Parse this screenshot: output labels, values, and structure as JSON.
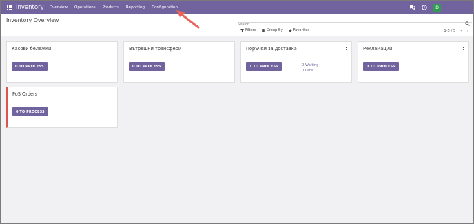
{
  "navbar": {
    "brand": "Inventory",
    "menu": [
      "Overview",
      "Operations",
      "Products",
      "Reporting",
      "Configuration"
    ],
    "avatar_letter": "D",
    "icons": [
      "apps-grid-icon",
      "chat-icon",
      "clock-icon"
    ]
  },
  "control_panel": {
    "title": "Inventory Overview",
    "search_placeholder": "Search...",
    "filters_label": "Filters",
    "group_by_label": "Group By",
    "favorites_label": "Favorites",
    "pager": "1-5 / 5"
  },
  "cards": [
    {
      "title": "Касови бележки",
      "button": "0 TO PROCESS"
    },
    {
      "title": "Вътрешни трансфери",
      "button": "0 TO PROCESS"
    },
    {
      "title": "Поръчки за доставка",
      "button": "1 TO PROCESS",
      "waiting": "0 Waiting",
      "late": "0 Late"
    },
    {
      "title": "Рекламации",
      "button": "0 TO PROCESS"
    },
    {
      "title": "PoS Orders",
      "button": "0 TO PROCESS"
    }
  ],
  "colors": {
    "brand": "#71639e",
    "accent_border": "#d9534f",
    "annotation_arrow": "#e8645a",
    "avatar": "#2e9d4e"
  }
}
